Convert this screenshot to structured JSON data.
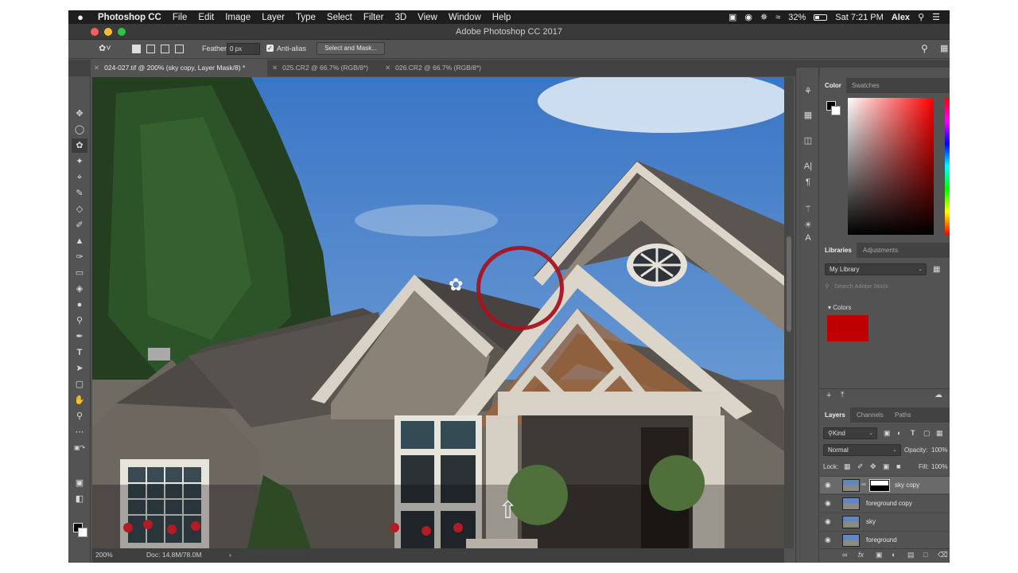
{
  "menubar": {
    "apple": "",
    "items": [
      "Photoshop CC",
      "File",
      "Edit",
      "Image",
      "Layer",
      "Type",
      "Select",
      "Filter",
      "3D",
      "View",
      "Window",
      "Help"
    ],
    "battery": "32%",
    "datetime": "Sat 7:21 PM",
    "user": "Alex"
  },
  "window": {
    "title": "Adobe Photoshop CC 2017"
  },
  "options": {
    "feather_label": "Feather:",
    "feather_value": "0 px",
    "antialias_label": "Anti-alias",
    "select_mask_label": "Select and Mask..."
  },
  "tabs": [
    {
      "label": "024-027.tif @ 200% (sky copy, Layer Mask/8) *",
      "active": true
    },
    {
      "label": "025.CR2 @ 66.7% (RGB/8*)",
      "active": false
    },
    {
      "label": "026.CR2 @ 66.7% (RGB/8*)",
      "active": false
    }
  ],
  "status": {
    "zoom": "200%",
    "doc": "Doc: 14.8M/78.0M",
    "arrow": "›"
  },
  "color_panel": {
    "tabs": [
      "Color",
      "Swatches"
    ]
  },
  "libraries_panel": {
    "tabs": [
      "Libraries",
      "Adjustments"
    ],
    "library": "My Library",
    "search_placeholder": "Search Adobe Stock",
    "colors_label": "Colors",
    "swatch_color": "#c00000"
  },
  "layers_panel": {
    "tabs": [
      "Layers",
      "Channels",
      "Paths"
    ],
    "kind": "Kind",
    "blend_mode": "Normal",
    "opacity_label": "Opacity:",
    "opacity_value": "100%",
    "lock_label": "Lock:",
    "fill_label": "Fill:",
    "fill_value": "100%",
    "layers": [
      {
        "name": "sky copy",
        "selected": true
      },
      {
        "name": "foreground copy",
        "selected": false
      },
      {
        "name": "sky",
        "selected": false
      },
      {
        "name": "foreground",
        "selected": false
      }
    ]
  },
  "colors": {
    "accent_red": "#c00000",
    "menubar_bg": "#1e1e1e",
    "panel_bg": "#535353"
  }
}
